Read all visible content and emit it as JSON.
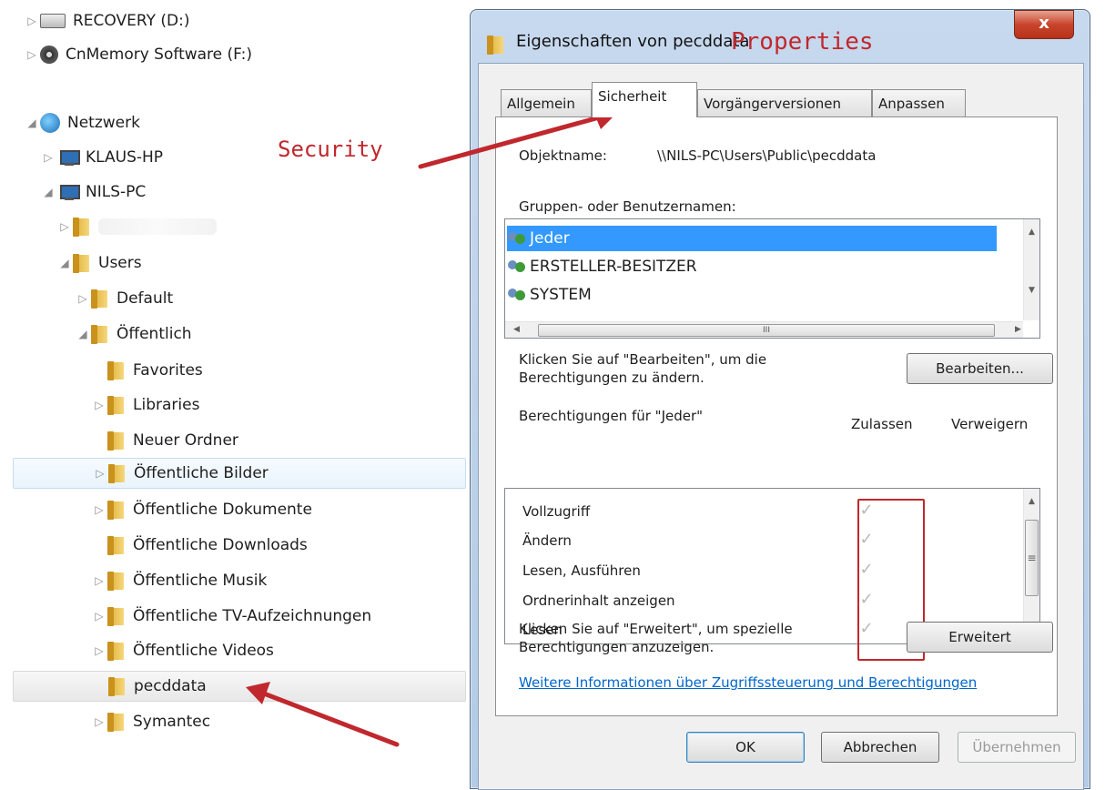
{
  "tree": [
    {
      "label": "RECOVERY (D:)",
      "icon": "drive-icon",
      "expander": "▷"
    },
    {
      "label": "CnMemory Software (F:)",
      "icon": "disc-icon",
      "expander": "▷"
    },
    {
      "label": "Netzwerk",
      "icon": "network-icon",
      "expander": "◢"
    },
    {
      "label": "KLAUS-HP",
      "icon": "computer-icon",
      "expander": "▷"
    },
    {
      "label": "NILS-PC",
      "icon": "computer-icon",
      "expander": "◢"
    },
    {
      "label": "",
      "icon": "share-folder-icon",
      "expander": "▷"
    },
    {
      "label": "Users",
      "icon": "share-folder-icon",
      "expander": "◢"
    },
    {
      "label": "Default",
      "icon": "folder-icon",
      "expander": "▷"
    },
    {
      "label": "Öffentlich",
      "icon": "folder-icon",
      "expander": "◢"
    },
    {
      "label": "Favorites",
      "icon": "folder-icon",
      "expander": ""
    },
    {
      "label": "Libraries",
      "icon": "folder-icon",
      "expander": "▷"
    },
    {
      "label": "Neuer Ordner",
      "icon": "folder-icon",
      "expander": ""
    },
    {
      "label": "Öffentliche Bilder",
      "icon": "folder-icon",
      "expander": "▷"
    },
    {
      "label": "Öffentliche Dokumente",
      "icon": "folder-icon",
      "expander": "▷"
    },
    {
      "label": "Öffentliche Downloads",
      "icon": "folder-icon",
      "expander": ""
    },
    {
      "label": "Öffentliche Musik",
      "icon": "folder-icon",
      "expander": "▷"
    },
    {
      "label": "Öffentliche TV-Aufzeichnungen",
      "icon": "folder-icon",
      "expander": "▷"
    },
    {
      "label": "Öffentliche Videos",
      "icon": "folder-icon",
      "expander": "▷"
    },
    {
      "label": "pecddata",
      "icon": "folder-icon",
      "expander": ""
    },
    {
      "label": "Symantec",
      "icon": "folder-icon",
      "expander": "▷"
    }
  ],
  "annotations": {
    "security": "Security",
    "properties": "Properties",
    "arrow_color": "#c0282d"
  },
  "dialog": {
    "title": "Eigenschaften von pecddata",
    "close_glyph": "x",
    "tabs": [
      "Allgemein",
      "Sicherheit",
      "Vorgängerversionen",
      "Anpassen"
    ],
    "object_label": "Objektname:",
    "object_value": "\\\\NILS-PC\\Users\\Public\\pecddata",
    "groups_label": "Gruppen- oder Benutzernamen:",
    "users": [
      "Jeder",
      "ERSTELLER-BESITZER",
      "SYSTEM"
    ],
    "edit_hint_1": "Klicken Sie auf \"Bearbeiten\", um die",
    "edit_hint_2": "Berechtigungen zu ändern.",
    "edit_button": "Bearbeiten...",
    "perm_label": "Berechtigungen für \"Jeder\"",
    "col_allow": "Zulassen",
    "col_deny": "Verweigern",
    "permissions": [
      {
        "name": "Vollzugriff",
        "allow": "✓"
      },
      {
        "name": "Ändern",
        "allow": "✓"
      },
      {
        "name": "Lesen, Ausführen",
        "allow": "✓"
      },
      {
        "name": "Ordnerinhalt anzeigen",
        "allow": "✓"
      },
      {
        "name": "Lesen",
        "allow": "✓"
      }
    ],
    "advanced_hint_1": "Klicken Sie auf \"Erweitert\", um spezielle",
    "advanced_hint_2": "Berechtigungen anzuzeigen.",
    "advanced_button": "Erweitert",
    "info_link": "Weitere Informationen über Zugriffssteuerung und Berechtigungen",
    "ok_button": "OK",
    "cancel_button": "Abbrechen",
    "apply_button": "Übernehmen",
    "scroll_mid_glyph": "III",
    "scroll_grip_glyph": "≡"
  }
}
